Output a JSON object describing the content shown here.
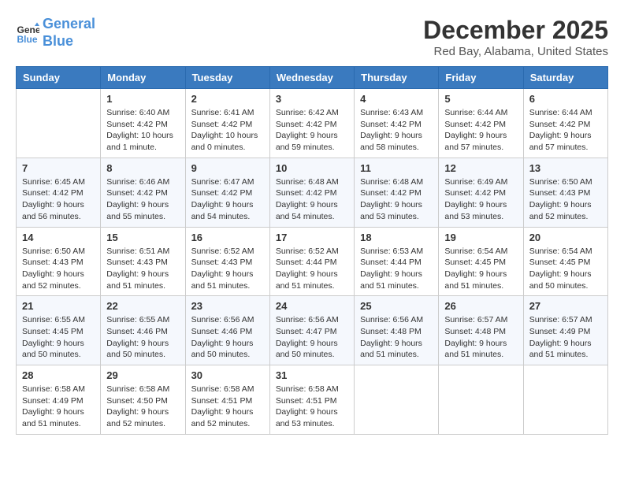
{
  "header": {
    "logo_line1": "General",
    "logo_line2": "Blue",
    "month": "December 2025",
    "location": "Red Bay, Alabama, United States"
  },
  "weekdays": [
    "Sunday",
    "Monday",
    "Tuesday",
    "Wednesday",
    "Thursday",
    "Friday",
    "Saturday"
  ],
  "weeks": [
    [
      {
        "day": "",
        "sunrise": "",
        "sunset": "",
        "daylight": ""
      },
      {
        "day": "1",
        "sunrise": "Sunrise: 6:40 AM",
        "sunset": "Sunset: 4:42 PM",
        "daylight": "Daylight: 10 hours and 1 minute."
      },
      {
        "day": "2",
        "sunrise": "Sunrise: 6:41 AM",
        "sunset": "Sunset: 4:42 PM",
        "daylight": "Daylight: 10 hours and 0 minutes."
      },
      {
        "day": "3",
        "sunrise": "Sunrise: 6:42 AM",
        "sunset": "Sunset: 4:42 PM",
        "daylight": "Daylight: 9 hours and 59 minutes."
      },
      {
        "day": "4",
        "sunrise": "Sunrise: 6:43 AM",
        "sunset": "Sunset: 4:42 PM",
        "daylight": "Daylight: 9 hours and 58 minutes."
      },
      {
        "day": "5",
        "sunrise": "Sunrise: 6:44 AM",
        "sunset": "Sunset: 4:42 PM",
        "daylight": "Daylight: 9 hours and 57 minutes."
      },
      {
        "day": "6",
        "sunrise": "Sunrise: 6:44 AM",
        "sunset": "Sunset: 4:42 PM",
        "daylight": "Daylight: 9 hours and 57 minutes."
      }
    ],
    [
      {
        "day": "7",
        "sunrise": "Sunrise: 6:45 AM",
        "sunset": "Sunset: 4:42 PM",
        "daylight": "Daylight: 9 hours and 56 minutes."
      },
      {
        "day": "8",
        "sunrise": "Sunrise: 6:46 AM",
        "sunset": "Sunset: 4:42 PM",
        "daylight": "Daylight: 9 hours and 55 minutes."
      },
      {
        "day": "9",
        "sunrise": "Sunrise: 6:47 AM",
        "sunset": "Sunset: 4:42 PM",
        "daylight": "Daylight: 9 hours and 54 minutes."
      },
      {
        "day": "10",
        "sunrise": "Sunrise: 6:48 AM",
        "sunset": "Sunset: 4:42 PM",
        "daylight": "Daylight: 9 hours and 54 minutes."
      },
      {
        "day": "11",
        "sunrise": "Sunrise: 6:48 AM",
        "sunset": "Sunset: 4:42 PM",
        "daylight": "Daylight: 9 hours and 53 minutes."
      },
      {
        "day": "12",
        "sunrise": "Sunrise: 6:49 AM",
        "sunset": "Sunset: 4:42 PM",
        "daylight": "Daylight: 9 hours and 53 minutes."
      },
      {
        "day": "13",
        "sunrise": "Sunrise: 6:50 AM",
        "sunset": "Sunset: 4:43 PM",
        "daylight": "Daylight: 9 hours and 52 minutes."
      }
    ],
    [
      {
        "day": "14",
        "sunrise": "Sunrise: 6:50 AM",
        "sunset": "Sunset: 4:43 PM",
        "daylight": "Daylight: 9 hours and 52 minutes."
      },
      {
        "day": "15",
        "sunrise": "Sunrise: 6:51 AM",
        "sunset": "Sunset: 4:43 PM",
        "daylight": "Daylight: 9 hours and 51 minutes."
      },
      {
        "day": "16",
        "sunrise": "Sunrise: 6:52 AM",
        "sunset": "Sunset: 4:43 PM",
        "daylight": "Daylight: 9 hours and 51 minutes."
      },
      {
        "day": "17",
        "sunrise": "Sunrise: 6:52 AM",
        "sunset": "Sunset: 4:44 PM",
        "daylight": "Daylight: 9 hours and 51 minutes."
      },
      {
        "day": "18",
        "sunrise": "Sunrise: 6:53 AM",
        "sunset": "Sunset: 4:44 PM",
        "daylight": "Daylight: 9 hours and 51 minutes."
      },
      {
        "day": "19",
        "sunrise": "Sunrise: 6:54 AM",
        "sunset": "Sunset: 4:45 PM",
        "daylight": "Daylight: 9 hours and 51 minutes."
      },
      {
        "day": "20",
        "sunrise": "Sunrise: 6:54 AM",
        "sunset": "Sunset: 4:45 PM",
        "daylight": "Daylight: 9 hours and 50 minutes."
      }
    ],
    [
      {
        "day": "21",
        "sunrise": "Sunrise: 6:55 AM",
        "sunset": "Sunset: 4:45 PM",
        "daylight": "Daylight: 9 hours and 50 minutes."
      },
      {
        "day": "22",
        "sunrise": "Sunrise: 6:55 AM",
        "sunset": "Sunset: 4:46 PM",
        "daylight": "Daylight: 9 hours and 50 minutes."
      },
      {
        "day": "23",
        "sunrise": "Sunrise: 6:56 AM",
        "sunset": "Sunset: 4:46 PM",
        "daylight": "Daylight: 9 hours and 50 minutes."
      },
      {
        "day": "24",
        "sunrise": "Sunrise: 6:56 AM",
        "sunset": "Sunset: 4:47 PM",
        "daylight": "Daylight: 9 hours and 50 minutes."
      },
      {
        "day": "25",
        "sunrise": "Sunrise: 6:56 AM",
        "sunset": "Sunset: 4:48 PM",
        "daylight": "Daylight: 9 hours and 51 minutes."
      },
      {
        "day": "26",
        "sunrise": "Sunrise: 6:57 AM",
        "sunset": "Sunset: 4:48 PM",
        "daylight": "Daylight: 9 hours and 51 minutes."
      },
      {
        "day": "27",
        "sunrise": "Sunrise: 6:57 AM",
        "sunset": "Sunset: 4:49 PM",
        "daylight": "Daylight: 9 hours and 51 minutes."
      }
    ],
    [
      {
        "day": "28",
        "sunrise": "Sunrise: 6:58 AM",
        "sunset": "Sunset: 4:49 PM",
        "daylight": "Daylight: 9 hours and 51 minutes."
      },
      {
        "day": "29",
        "sunrise": "Sunrise: 6:58 AM",
        "sunset": "Sunset: 4:50 PM",
        "daylight": "Daylight: 9 hours and 52 minutes."
      },
      {
        "day": "30",
        "sunrise": "Sunrise: 6:58 AM",
        "sunset": "Sunset: 4:51 PM",
        "daylight": "Daylight: 9 hours and 52 minutes."
      },
      {
        "day": "31",
        "sunrise": "Sunrise: 6:58 AM",
        "sunset": "Sunset: 4:51 PM",
        "daylight": "Daylight: 9 hours and 53 minutes."
      },
      {
        "day": "",
        "sunrise": "",
        "sunset": "",
        "daylight": ""
      },
      {
        "day": "",
        "sunrise": "",
        "sunset": "",
        "daylight": ""
      },
      {
        "day": "",
        "sunrise": "",
        "sunset": "",
        "daylight": ""
      }
    ]
  ]
}
